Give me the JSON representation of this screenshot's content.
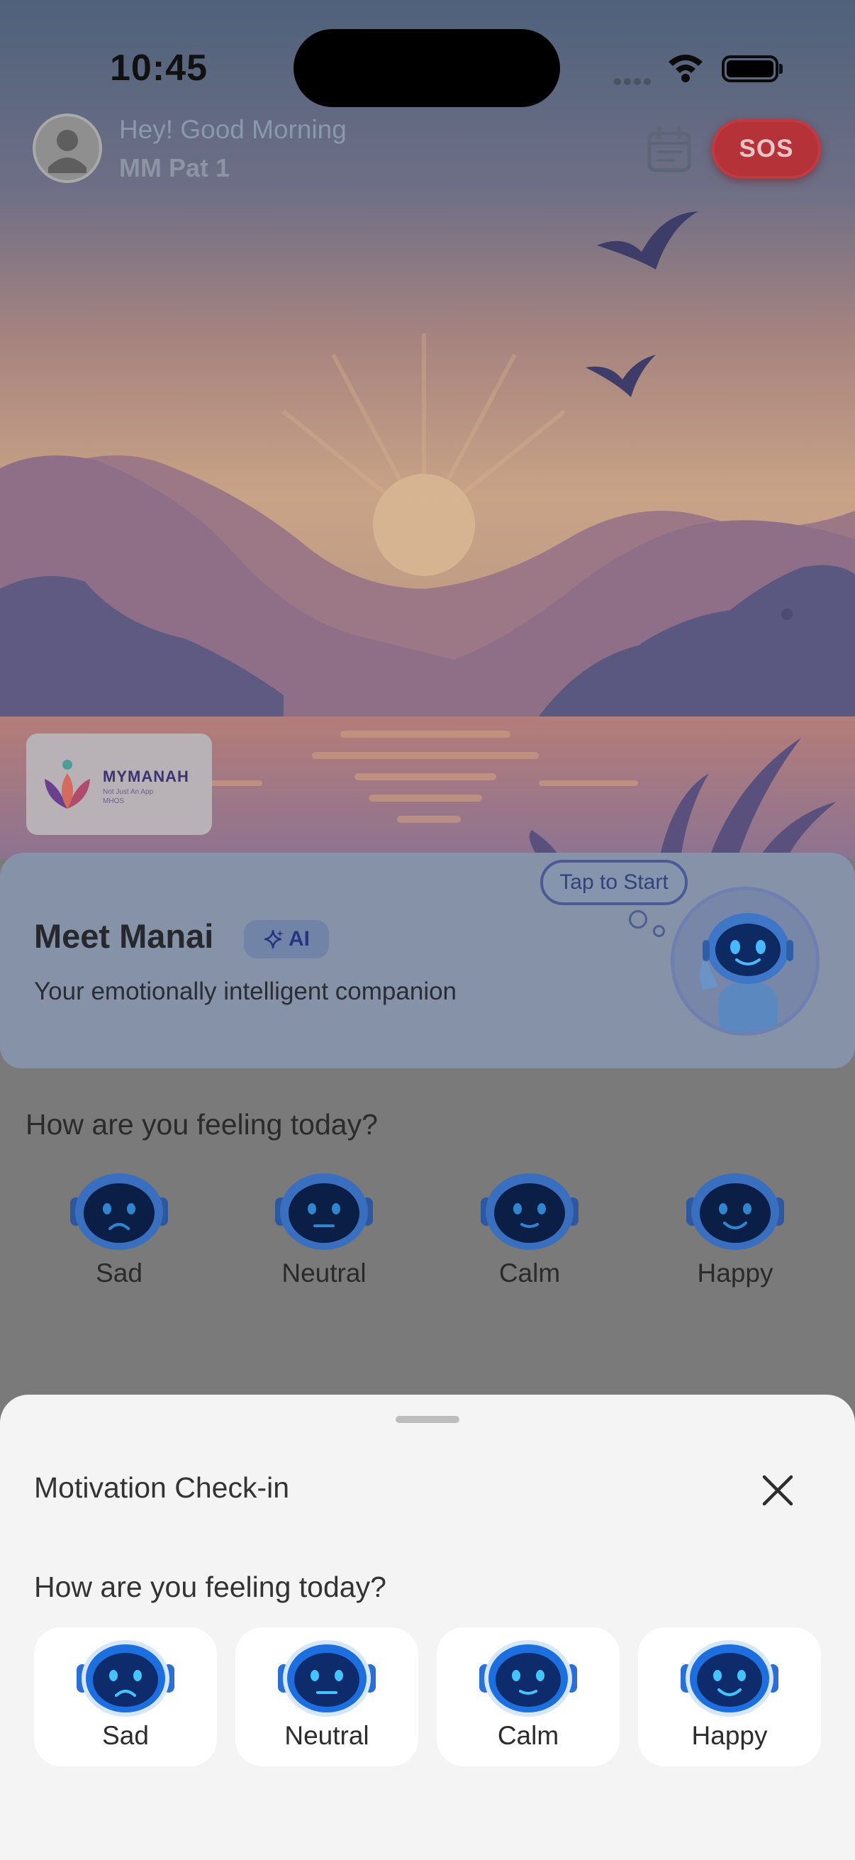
{
  "status_bar": {
    "time": "10:45"
  },
  "header": {
    "greeting": "Hey! Good Morning",
    "user_name": "MM Pat 1",
    "sos_label": "SOS"
  },
  "logo": {
    "title": "MYMANAH",
    "tagline": "Not Just An App",
    "sub": "MHOS"
  },
  "manai_card": {
    "title": "Meet Manai",
    "badge": "AI",
    "subtitle": "Your emotionally intelligent companion",
    "cta": "Tap to Start"
  },
  "feeling_section": {
    "question": "How are you feeling today?",
    "moods": [
      {
        "label": "Sad",
        "icon": "robot-sad-icon"
      },
      {
        "label": "Neutral",
        "icon": "robot-neutral-icon"
      },
      {
        "label": "Calm",
        "icon": "robot-calm-icon"
      },
      {
        "label": "Happy",
        "icon": "robot-happy-icon"
      }
    ]
  },
  "sheet": {
    "title": "Motivation Check-in",
    "question": "How are you feeling today?",
    "moods": [
      {
        "label": "Sad",
        "icon": "robot-sad-icon"
      },
      {
        "label": "Neutral",
        "icon": "robot-neutral-icon"
      },
      {
        "label": "Calm",
        "icon": "robot-calm-icon"
      },
      {
        "label": "Happy",
        "icon": "robot-happy-icon"
      }
    ]
  },
  "colors": {
    "sos": "#b63239",
    "accent_blue": "#1d6fe0",
    "sheet_bg": "#f4f4f4",
    "overlay_dim": "#7a7a7a"
  }
}
